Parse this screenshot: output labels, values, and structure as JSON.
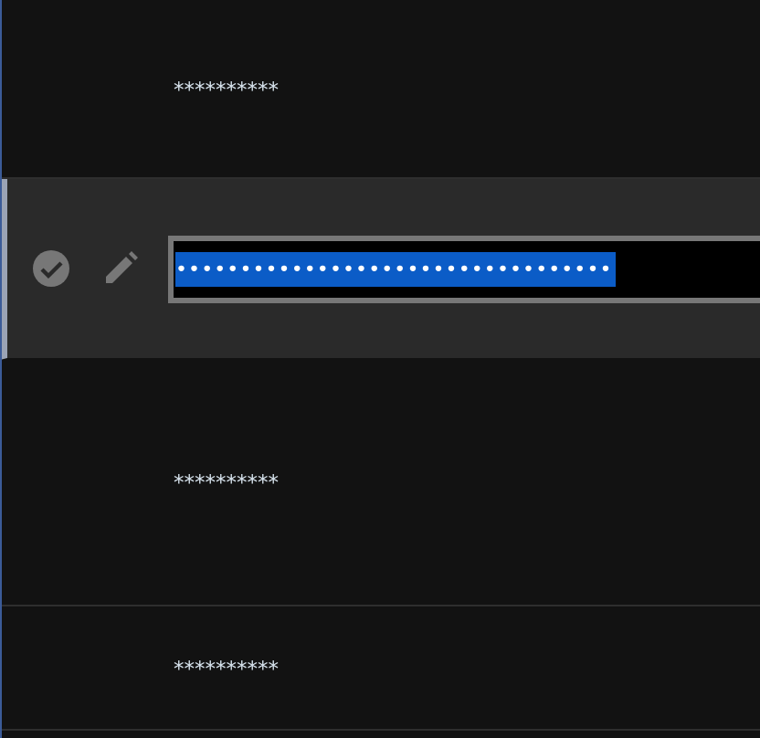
{
  "rows": [
    {
      "kind": "masked",
      "selected": false,
      "value": "**********"
    },
    {
      "kind": "editing",
      "selected": true,
      "value": "••••••••••••••••••••••••••••••••••"
    },
    {
      "kind": "masked",
      "selected": false,
      "value": "**********"
    },
    {
      "kind": "masked",
      "selected": false,
      "value": "**********"
    }
  ]
}
